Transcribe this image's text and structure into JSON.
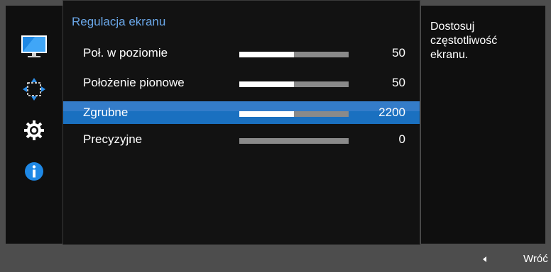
{
  "sidebar": {
    "items": [
      {
        "icon": "monitor-icon",
        "active": true
      },
      {
        "icon": "move-arrows-icon",
        "active": false
      },
      {
        "icon": "gear-icon",
        "active": false
      },
      {
        "icon": "info-icon",
        "active": false
      }
    ]
  },
  "main": {
    "title": "Regulacja ekranu",
    "rows": [
      {
        "label": "Poł. w poziomie",
        "value": "50",
        "level": 0.5
      },
      {
        "label": "Położenie pionowe",
        "value": "50",
        "level": 0.5
      },
      {
        "label": "Zgrubne",
        "value": "2200",
        "level": 0.5,
        "selected": true
      },
      {
        "label": "Precyzyjne",
        "value": "0",
        "level": 0.0
      }
    ]
  },
  "help": {
    "text_line1": "Dostosuj",
    "text_line2": "częstotliwość",
    "text_line3": "ekranu."
  },
  "footer": {
    "back_label": "Wróć"
  },
  "colors": {
    "accent": "#1a70c0",
    "title": "#6aa7e8",
    "bar_track": "#8a8a8a",
    "bar_fill": "#ffffff"
  }
}
